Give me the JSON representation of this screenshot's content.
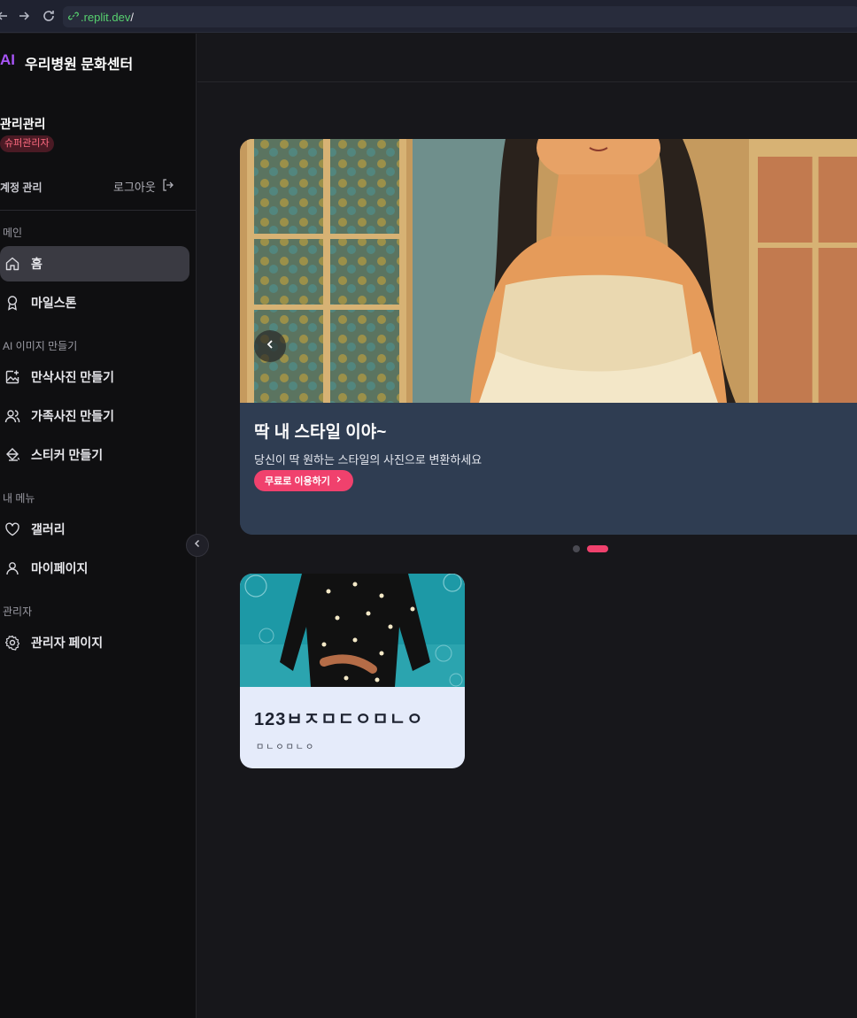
{
  "browser": {
    "url_host": ".replit.dev",
    "url_path": "/"
  },
  "app": {
    "logo_mark": "AI",
    "title": "우리병원 문화센터"
  },
  "user": {
    "name": "관리관리",
    "role": "슈퍼관리자",
    "account_label": "계정 관리",
    "logout_label": "로그아웃"
  },
  "sidebar": {
    "sections": [
      {
        "label": "메인"
      },
      {
        "label": "AI 이미지 만들기"
      },
      {
        "label": "내 메뉴"
      },
      {
        "label": "관리자"
      }
    ],
    "items": [
      {
        "label": "홈",
        "icon": "home-icon",
        "active": true
      },
      {
        "label": "마일스톤",
        "icon": "award-icon"
      },
      {
        "label": "만삭사진 만들기",
        "icon": "image-plus-icon"
      },
      {
        "label": "가족사진 만들기",
        "icon": "users-icon"
      },
      {
        "label": "스티커 만들기",
        "icon": "paint-bucket-icon"
      },
      {
        "label": "갤러리",
        "icon": "heart-icon"
      },
      {
        "label": "마이페이지",
        "icon": "user-icon"
      },
      {
        "label": "관리자 페이지",
        "icon": "settings-icon"
      }
    ]
  },
  "banner": {
    "title": "딱 내 스타일 이야~",
    "subtitle": "당신이 딱 원하는 스타일의 사진으로 변환하세요",
    "cta_label": "무료로 이용하기",
    "slide_count": 2,
    "active_slide": 2
  },
  "card": {
    "title": "123ㅂㅈㅁㄷㅇㅁㄴㅇ",
    "description": "ㅁㄴㅇㅁㄴㅇ"
  },
  "colors": {
    "accent": "#f0416d",
    "logo": "#a855f7",
    "sidebar_bg": "#0f0f11",
    "main_bg": "#17171b",
    "banner_caption_bg": "#2f3d52"
  }
}
